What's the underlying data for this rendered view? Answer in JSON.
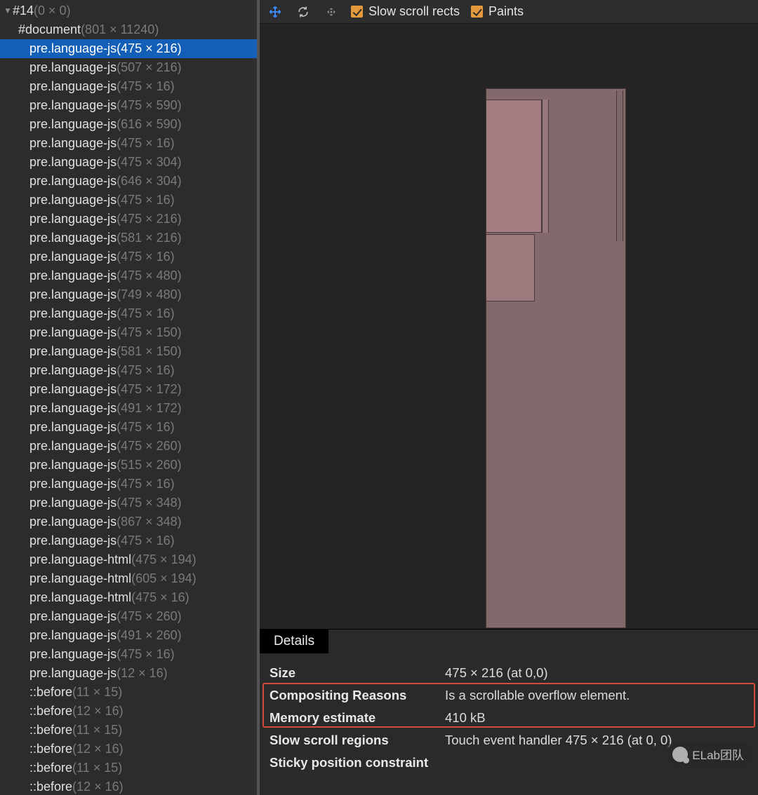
{
  "tree": {
    "root": {
      "label": "#14",
      "dims": "(0 × 0)"
    },
    "items": [
      {
        "label": "#document",
        "dims": "(801 × 11240)",
        "level": 1
      },
      {
        "label": "pre.language-js",
        "dims": "(475 × 216)",
        "level": 2,
        "selected": true
      },
      {
        "label": "pre.language-js",
        "dims": "(507 × 216)",
        "level": 2
      },
      {
        "label": "pre.language-js",
        "dims": "(475 × 16)",
        "level": 2
      },
      {
        "label": "pre.language-js",
        "dims": "(475 × 590)",
        "level": 2
      },
      {
        "label": "pre.language-js",
        "dims": "(616 × 590)",
        "level": 2
      },
      {
        "label": "pre.language-js",
        "dims": "(475 × 16)",
        "level": 2
      },
      {
        "label": "pre.language-js",
        "dims": "(475 × 304)",
        "level": 2
      },
      {
        "label": "pre.language-js",
        "dims": "(646 × 304)",
        "level": 2
      },
      {
        "label": "pre.language-js",
        "dims": "(475 × 16)",
        "level": 2
      },
      {
        "label": "pre.language-js",
        "dims": "(475 × 216)",
        "level": 2
      },
      {
        "label": "pre.language-js",
        "dims": "(581 × 216)",
        "level": 2
      },
      {
        "label": "pre.language-js",
        "dims": "(475 × 16)",
        "level": 2
      },
      {
        "label": "pre.language-js",
        "dims": "(475 × 480)",
        "level": 2
      },
      {
        "label": "pre.language-js",
        "dims": "(749 × 480)",
        "level": 2
      },
      {
        "label": "pre.language-js",
        "dims": "(475 × 16)",
        "level": 2
      },
      {
        "label": "pre.language-js",
        "dims": "(475 × 150)",
        "level": 2
      },
      {
        "label": "pre.language-js",
        "dims": "(581 × 150)",
        "level": 2
      },
      {
        "label": "pre.language-js",
        "dims": "(475 × 16)",
        "level": 2
      },
      {
        "label": "pre.language-js",
        "dims": "(475 × 172)",
        "level": 2
      },
      {
        "label": "pre.language-js",
        "dims": "(491 × 172)",
        "level": 2
      },
      {
        "label": "pre.language-js",
        "dims": "(475 × 16)",
        "level": 2
      },
      {
        "label": "pre.language-js",
        "dims": "(475 × 260)",
        "level": 2
      },
      {
        "label": "pre.language-js",
        "dims": "(515 × 260)",
        "level": 2
      },
      {
        "label": "pre.language-js",
        "dims": "(475 × 16)",
        "level": 2
      },
      {
        "label": "pre.language-js",
        "dims": "(475 × 348)",
        "level": 2
      },
      {
        "label": "pre.language-js",
        "dims": "(867 × 348)",
        "level": 2
      },
      {
        "label": "pre.language-js",
        "dims": "(475 × 16)",
        "level": 2
      },
      {
        "label": "pre.language-html",
        "dims": "(475 × 194)",
        "level": 2
      },
      {
        "label": "pre.language-html",
        "dims": "(605 × 194)",
        "level": 2
      },
      {
        "label": "pre.language-html",
        "dims": "(475 × 16)",
        "level": 2
      },
      {
        "label": "pre.language-js",
        "dims": "(475 × 260)",
        "level": 2
      },
      {
        "label": "pre.language-js",
        "dims": "(491 × 260)",
        "level": 2
      },
      {
        "label": "pre.language-js",
        "dims": "(475 × 16)",
        "level": 2
      },
      {
        "label": "pre.language-js",
        "dims": "(12 × 16)",
        "level": 2
      },
      {
        "label": "::before",
        "dims": "(11 × 15)",
        "level": 2
      },
      {
        "label": "::before",
        "dims": "(12 × 16)",
        "level": 2
      },
      {
        "label": "::before",
        "dims": "(11 × 15)",
        "level": 2
      },
      {
        "label": "::before",
        "dims": "(12 × 16)",
        "level": 2
      },
      {
        "label": "::before",
        "dims": "(11 × 15)",
        "level": 2
      },
      {
        "label": "::before",
        "dims": "(12 × 16)",
        "level": 2
      }
    ]
  },
  "toolbar": {
    "slow_scroll_label": "Slow scroll rects",
    "paints_label": "Paints"
  },
  "details": {
    "tab": "Details",
    "rows": [
      {
        "k": "Size",
        "v": "475 × 216 (at 0,0)"
      },
      {
        "k": "Compositing Reasons",
        "v": "Is a scrollable overflow element."
      },
      {
        "k": "Memory estimate",
        "v": "410 kB"
      },
      {
        "k": "Slow scroll regions",
        "v": "Touch event handler 475 × 216 (at 0, 0)"
      },
      {
        "k": "Sticky position constraint",
        "v": ""
      }
    ]
  },
  "watermark": "ELab团队"
}
